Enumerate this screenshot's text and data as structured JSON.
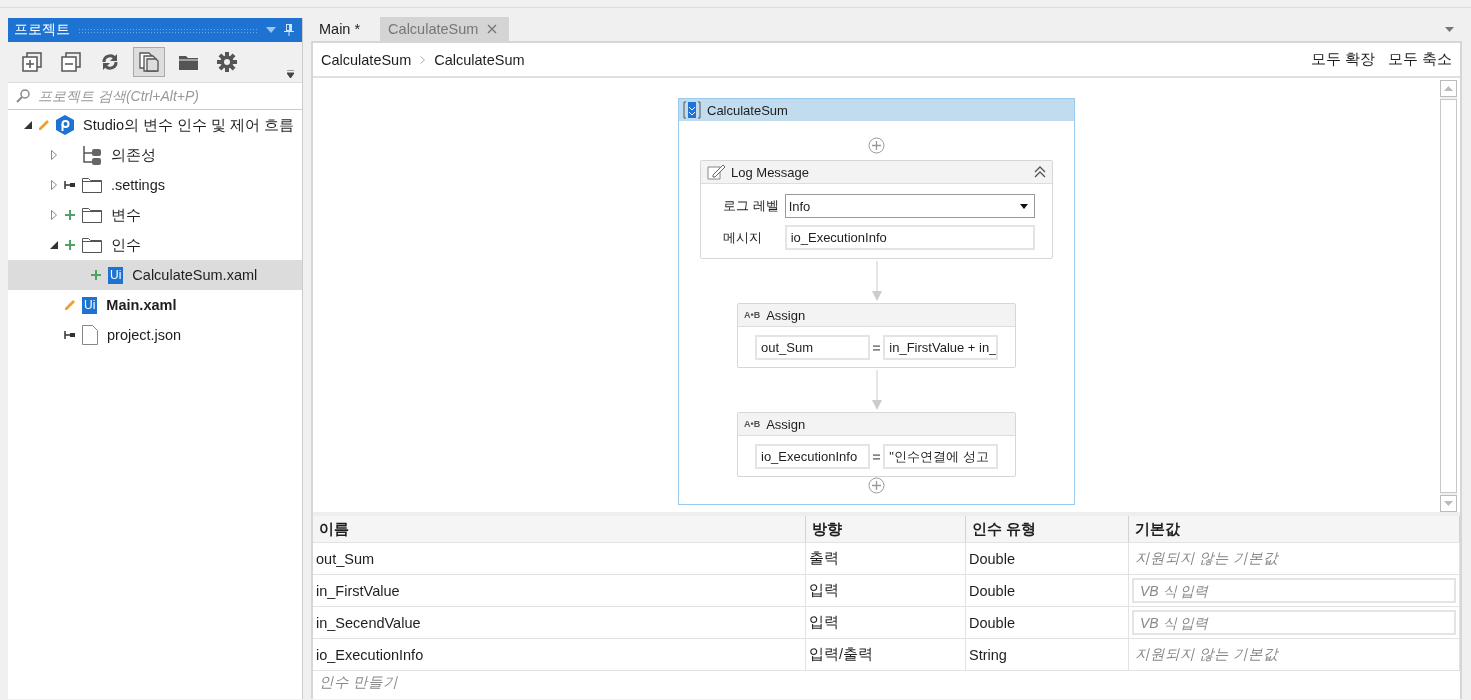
{
  "project_panel": {
    "title": "프로젝트",
    "toolbar": [
      {
        "kind": "expand-all",
        "pressed": false
      },
      {
        "kind": "collapse-all",
        "pressed": false
      },
      {
        "kind": "refresh",
        "pressed": false
      },
      {
        "kind": "show-files",
        "pressed": true
      },
      {
        "kind": "open-folder",
        "pressed": false
      },
      {
        "kind": "settings",
        "pressed": false
      }
    ],
    "search": {
      "placeholder": "프로젝트 검색(Ctrl+Alt+P)"
    },
    "tree": [
      {
        "label": "Studio의 변수 인수 및 제어 흐름",
        "kind": "project",
        "modified": true,
        "added": false,
        "excluded": false,
        "expanded": true,
        "selected": false,
        "bold": false,
        "children": [
          {
            "label": "의존성",
            "kind": "dependencies",
            "modified": false,
            "added": false,
            "excluded": false,
            "expanded": false,
            "selected": false,
            "bold": false
          },
          {
            "label": ".settings",
            "kind": "folder",
            "modified": false,
            "added": false,
            "excluded": true,
            "expanded": false,
            "selected": false,
            "bold": false
          },
          {
            "label": "변수",
            "kind": "folder",
            "modified": false,
            "added": true,
            "excluded": false,
            "expanded": false,
            "selected": false,
            "bold": false
          },
          {
            "label": "인수",
            "kind": "folder",
            "modified": false,
            "added": true,
            "excluded": false,
            "expanded": true,
            "selected": false,
            "bold": false,
            "children": [
              {
                "label": "CalculateSum.xaml",
                "kind": "workflow",
                "icon_text": "Ui",
                "modified": false,
                "added": true,
                "excluded": false,
                "selected": true,
                "bold": false
              }
            ]
          },
          {
            "label": "Main.xaml",
            "kind": "workflow",
            "icon_text": "Ui",
            "modified": true,
            "added": false,
            "excluded": false,
            "selected": false,
            "bold": true
          },
          {
            "label": "project.json",
            "kind": "file",
            "modified": false,
            "added": false,
            "excluded": true,
            "selected": false,
            "bold": false
          }
        ]
      }
    ]
  },
  "tabs": [
    {
      "label": "Main *",
      "selected": true,
      "closable": false
    },
    {
      "label": "CalculateSum",
      "selected": false,
      "closable": true
    }
  ],
  "breadcrumb": [
    "CalculateSum",
    "CalculateSum"
  ],
  "actions": [
    "모두 확장",
    "모두 축소"
  ],
  "sequence": {
    "title": "CalculateSum",
    "activities": [
      {
        "kind": "log",
        "title": "Log Message",
        "fields": [
          {
            "label": "로그 레벨",
            "kind": "dropdown",
            "value": "Info"
          },
          {
            "label": "메시지",
            "kind": "text",
            "value": "io_ExecutionInfo"
          }
        ]
      },
      {
        "kind": "assign",
        "title": "Assign",
        "icon_text": "A•B",
        "to": "out_Sum",
        "value": "in_FirstValue + in_"
      },
      {
        "kind": "assign",
        "title": "Assign",
        "icon_text": "A•B",
        "to": "io_ExecutionInfo",
        "value": "\"인수연결에 성고"
      }
    ]
  },
  "arguments": {
    "columns": [
      "이름",
      "방향",
      "인수 유형",
      "기본값"
    ],
    "rows": [
      {
        "name": "out_Sum",
        "direction": "출력",
        "type": "Double",
        "default": {
          "kind": "note",
          "text": "지원되지 않는 기본값"
        }
      },
      {
        "name": "in_FirstValue",
        "direction": "입력",
        "type": "Double",
        "default": {
          "kind": "input",
          "placeholder": "VB 식 입력"
        }
      },
      {
        "name": "in_SecendValue",
        "direction": "입력",
        "type": "Double",
        "default": {
          "kind": "input",
          "placeholder": "VB 식 입력"
        }
      },
      {
        "name": "io_ExecutionInfo",
        "direction": "입력/출력",
        "type": "String",
        "default": {
          "kind": "note",
          "text": "지원되지 않는 기본값"
        }
      }
    ],
    "create_placeholder": "인수 만들기"
  }
}
